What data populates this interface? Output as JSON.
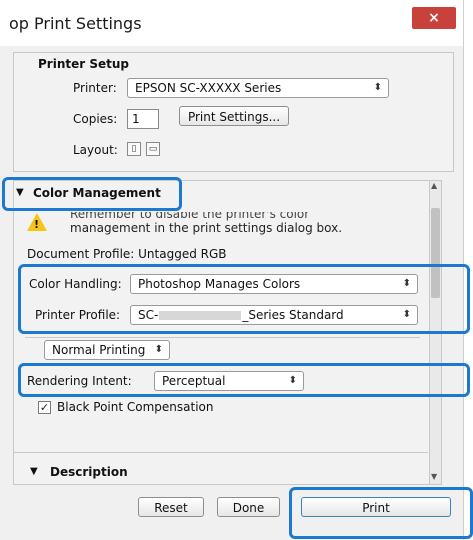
{
  "window": {
    "title": "op Print Settings",
    "close_glyph": "×"
  },
  "printer_setup": {
    "heading": "Printer Setup",
    "printer_label": "Printer:",
    "printer_value": "EPSON SC-XXXXX Series",
    "copies_label": "Copies:",
    "copies_value": "1",
    "print_settings_button": "Print Settings...",
    "layout_label": "Layout:"
  },
  "color_management": {
    "heading": "Color Management",
    "warning_line1": "Remember to disable the printer's color",
    "warning_line2": "management in the print settings dialog box.",
    "document_profile": "Document Profile: Untagged RGB",
    "color_handling_label": "Color Handling:",
    "color_handling_value": "Photoshop Manages Colors",
    "printer_profile_label": "Printer Profile:",
    "printer_profile_value_prefix": "SC-",
    "printer_profile_value_suffix": "_Series Standard",
    "printing_mode_value": "Normal Printing",
    "rendering_intent_label": "Rendering Intent:",
    "rendering_intent_value": "Perceptual",
    "bpc_label": "Black Point Compensation",
    "bpc_checked": true
  },
  "description": {
    "heading": "Description"
  },
  "footer": {
    "reset": "Reset",
    "done": "Done",
    "print": "Print"
  },
  "colors": {
    "highlight": "#1d78d2",
    "close_button": "#c8413a",
    "warning": "#f5c518"
  },
  "icons": {
    "expanded": "triangle-down-icon",
    "warning": "warning-icon",
    "dropdown": "updown-arrows-icon",
    "layout_portrait": "portrait-layout-icon",
    "layout_landscape": "landscape-layout-icon",
    "checkbox": "checkbox-checked-icon"
  }
}
